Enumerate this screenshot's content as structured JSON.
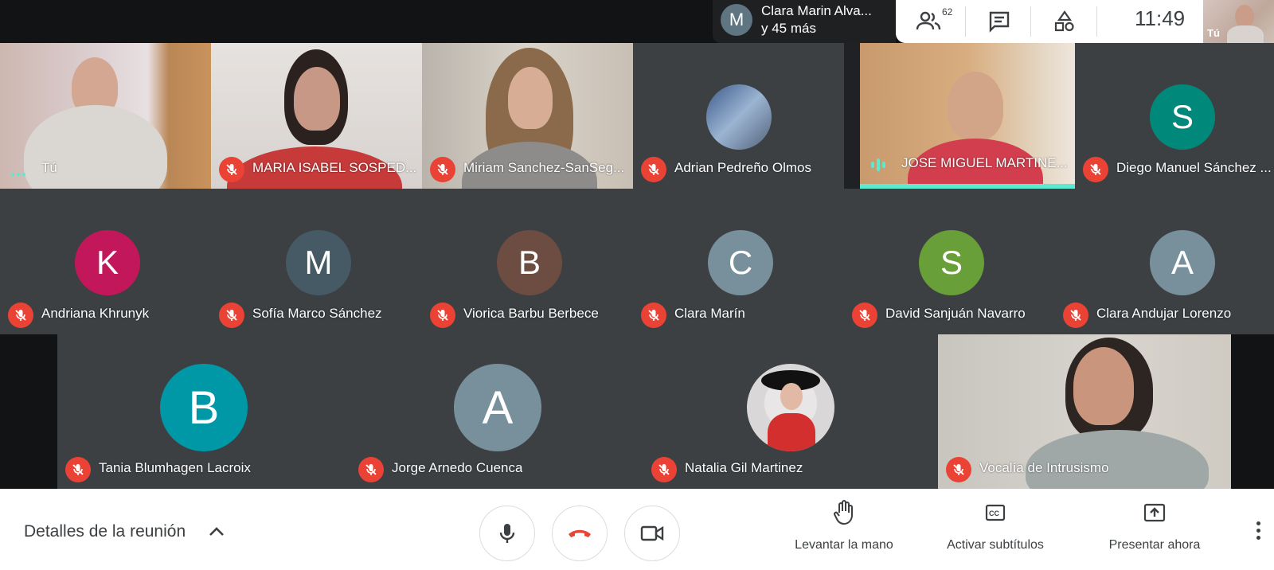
{
  "presenter": {
    "avatar_letter": "M",
    "name_line1": "Clara Marin Alva...",
    "name_line2": "y 45 más"
  },
  "topbar": {
    "people_icon": "people-icon",
    "people_count": "62",
    "chat_icon": "chat-icon",
    "activities_icon": "activities-icon",
    "clock": "11:49"
  },
  "self_view": {
    "label": "Tú"
  },
  "row1": [
    {
      "name": "Tú",
      "state": "speaking-dots",
      "type": "video"
    },
    {
      "name": "MARIA ISABEL SOSPED...",
      "state": "muted",
      "type": "video"
    },
    {
      "name": "Miriam Sanchez-SanSeg...",
      "state": "muted",
      "type": "video"
    },
    {
      "name": "Adrian Pedreño Olmos",
      "state": "muted",
      "type": "photo-avatar"
    },
    {
      "name": "JOSE MIGUEL MARTINE...",
      "state": "speaking",
      "type": "video"
    },
    {
      "name": "Diego Manuel Sánchez ...",
      "state": "muted",
      "type": "letter",
      "letter": "S",
      "color": "#00897b"
    }
  ],
  "row2": [
    {
      "name": "Andriana Khrunyk",
      "letter": "K",
      "color": "#c2185b"
    },
    {
      "name": "Sofía Marco Sánchez",
      "letter": "M",
      "color": "#455a64"
    },
    {
      "name": "Viorica Barbu Berbece",
      "letter": "B",
      "color": "#6d4c41"
    },
    {
      "name": "Clara Marín",
      "letter": "C",
      "color": "#78909c"
    },
    {
      "name": "David Sanjuán Navarro",
      "letter": "S",
      "color": "#689f38"
    },
    {
      "name": "Clara Andujar Lorenzo",
      "letter": "A",
      "color": "#78909c"
    }
  ],
  "row3": [
    {
      "name": "Tania Blumhagen Lacroix",
      "letter": "B",
      "color": "#0097a7",
      "type": "letter"
    },
    {
      "name": "Jorge Arnedo Cuenca",
      "letter": "A",
      "color": "#78909c",
      "type": "letter"
    },
    {
      "name": "Natalia Gil Martinez",
      "type": "photo-avatar"
    },
    {
      "name": "Vocalía de Intrusismo",
      "type": "video"
    }
  ],
  "bottombar": {
    "details_label": "Detalles de la reunión",
    "raise_hand_label": "Levantar la mano",
    "captions_label": "Activar subtítulos",
    "present_label": "Presentar ahora"
  },
  "colors": {
    "muted_red": "#ea4335",
    "speaking_teal": "#5de8d0",
    "tile_dark": "#3c4043",
    "bg": "#202124"
  }
}
